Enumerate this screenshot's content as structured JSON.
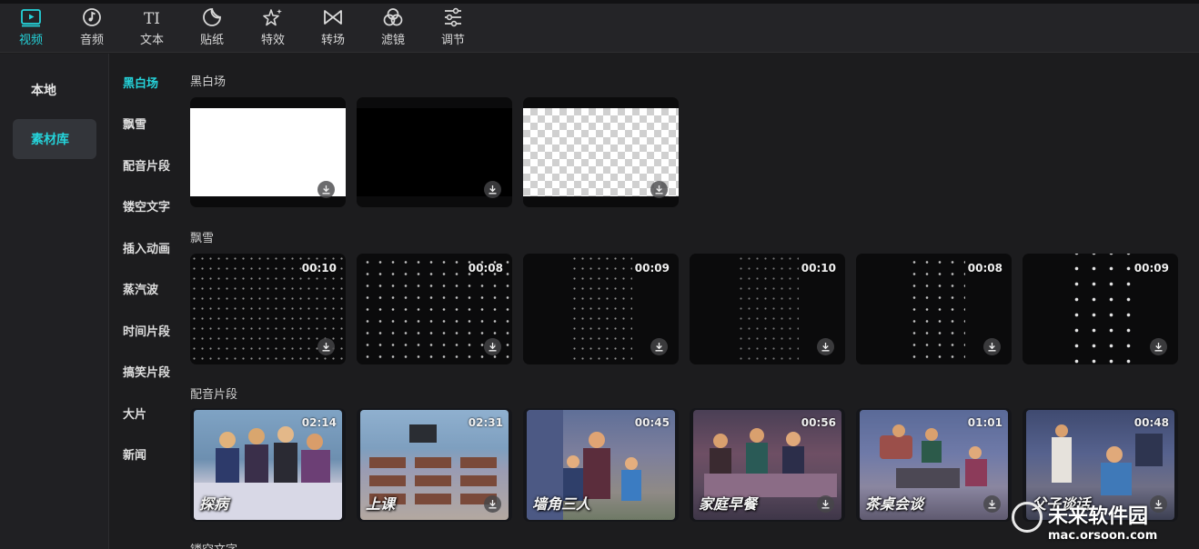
{
  "tabs": [
    {
      "label": "视频",
      "icon": "video-icon",
      "active": true
    },
    {
      "label": "音频",
      "icon": "music-note-icon"
    },
    {
      "label": "文本",
      "icon": "text-icon",
      "glyph": "TI"
    },
    {
      "label": "贴纸",
      "icon": "sticker-icon"
    },
    {
      "label": "特效",
      "icon": "sparkle-star-icon"
    },
    {
      "label": "转场",
      "icon": "transition-bowtie-icon"
    },
    {
      "label": "滤镜",
      "icon": "filter-circles-icon"
    },
    {
      "label": "调节",
      "icon": "sliders-icon"
    }
  ],
  "left_panel": {
    "items": [
      {
        "label": "本地"
      },
      {
        "label": "素材库",
        "active": true
      }
    ]
  },
  "categories": [
    "黑白场",
    "飘雪",
    "配音片段",
    "镂空文字",
    "插入动画",
    "蒸汽波",
    "时间片段",
    "搞笑片段",
    "大片",
    "新闻"
  ],
  "sections": {
    "black_white": {
      "title": "黑白场",
      "cards": [
        {
          "fill": "white",
          "icon": "download-icon"
        },
        {
          "fill": "black",
          "icon": "download-icon"
        },
        {
          "fill": "transparent",
          "icon": "download-icon"
        }
      ]
    },
    "snow": {
      "title": "飘雪",
      "cards": [
        {
          "duration": "00:10"
        },
        {
          "duration": "00:08"
        },
        {
          "duration": "00:09"
        },
        {
          "duration": "00:10"
        },
        {
          "duration": "00:08"
        },
        {
          "duration": "00:09"
        }
      ]
    },
    "dubbing": {
      "title": "配音片段",
      "cards": [
        {
          "duration": "02:14",
          "caption": "探病"
        },
        {
          "duration": "02:31",
          "caption": "上课"
        },
        {
          "duration": "00:45",
          "caption": "墙角三人"
        },
        {
          "duration": "00:56",
          "caption": "家庭早餐"
        },
        {
          "duration": "01:01",
          "caption": "茶桌会谈"
        },
        {
          "duration": "00:48",
          "caption": "父子谈话"
        }
      ]
    },
    "hollow_text": {
      "title": "镂空文字"
    }
  },
  "watermark": {
    "text": "未来软件园",
    "url": "mac.orsoon.com"
  },
  "colors": {
    "accent": "#25d3da",
    "background": "#1c1c1e",
    "topbar": "#242427"
  }
}
